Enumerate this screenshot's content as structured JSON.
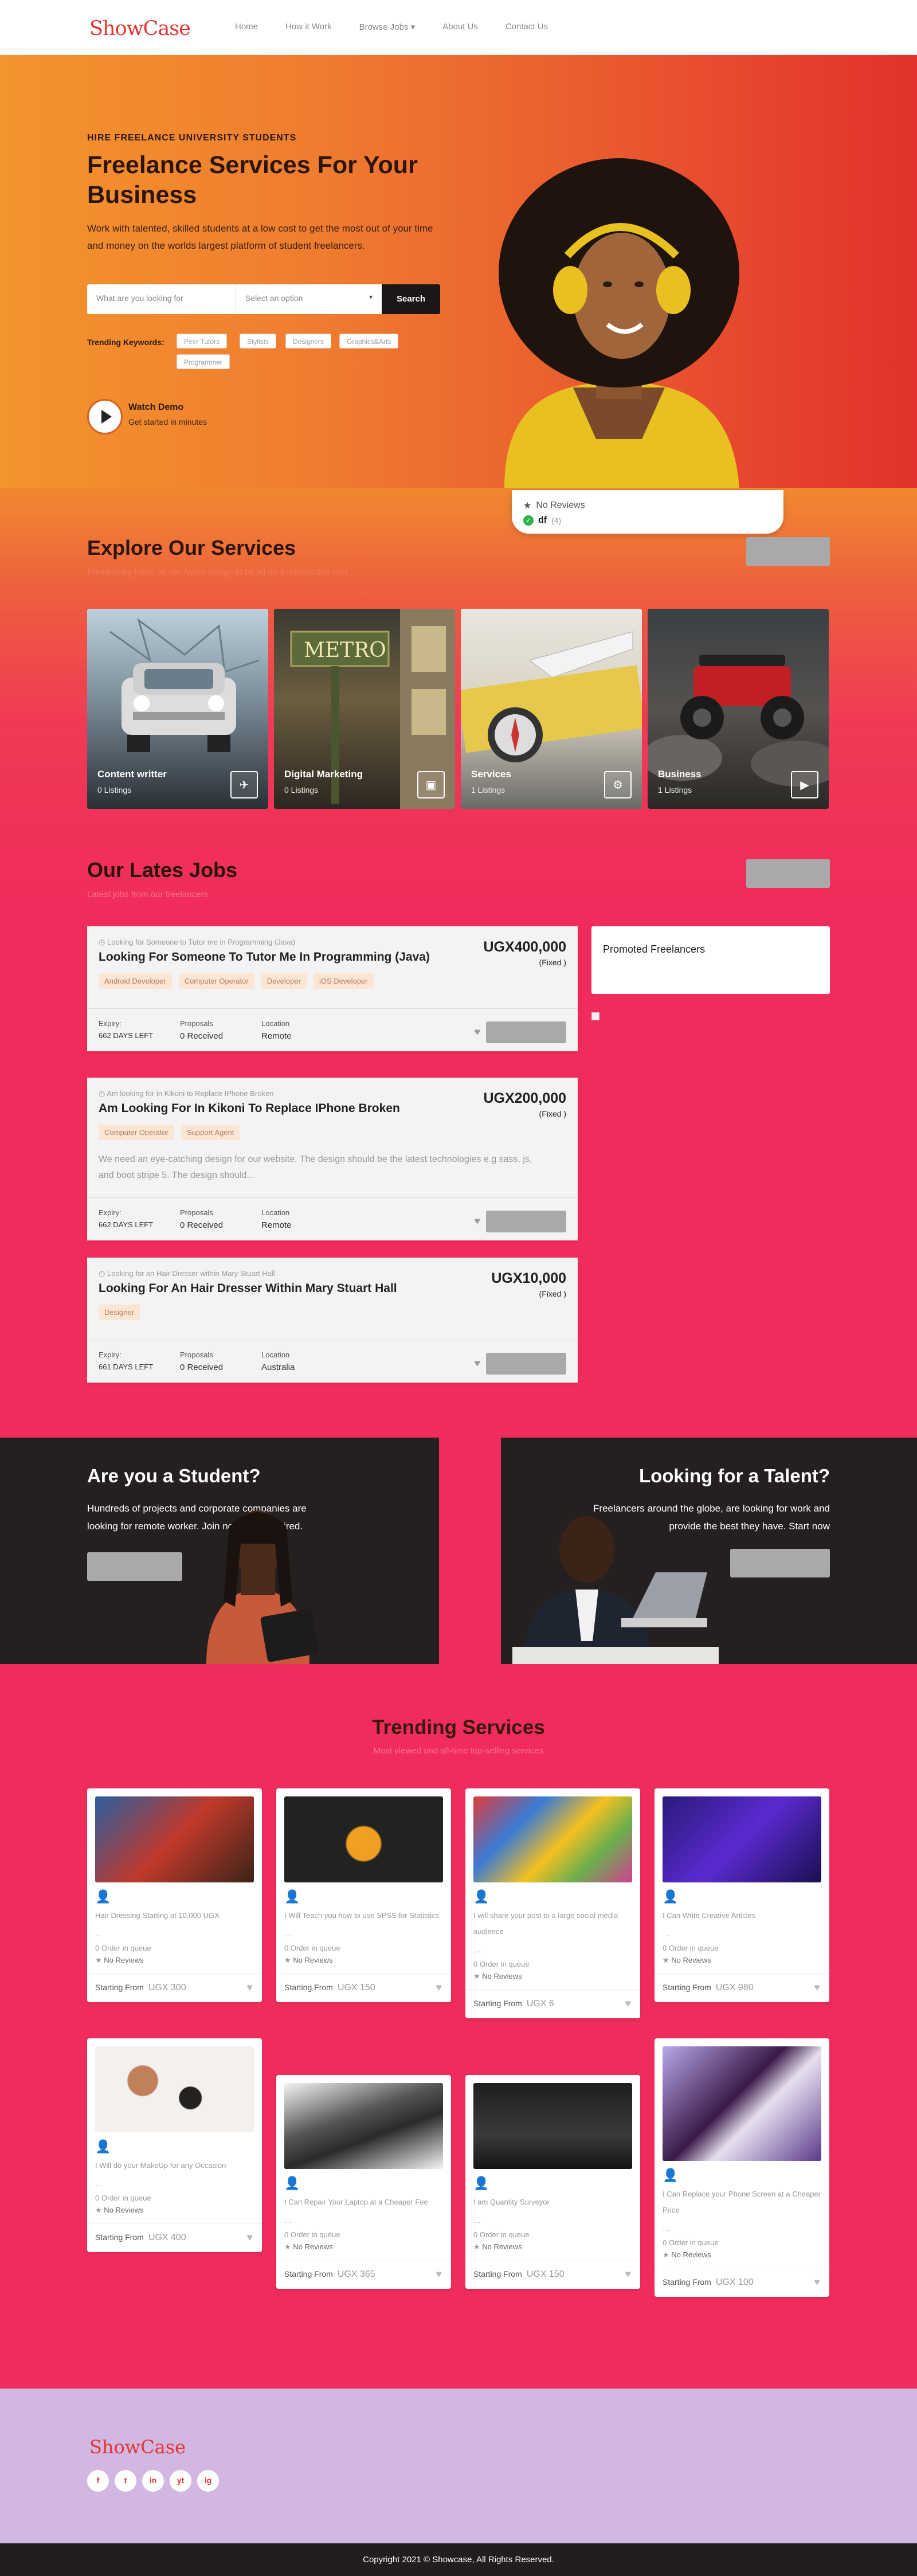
{
  "header": {
    "logo": "ShowCase",
    "nav": [
      "Home",
      "How it Work",
      "Browse Jobs",
      "About Us",
      "Contact Us"
    ]
  },
  "hero": {
    "kicker": "HIRE FREELANCE UNIVERSITY STUDENTS",
    "title": "Freelance Services For Your Business",
    "subtitle": "Work with talented, skilled students at a low cost to get the most out of your time and money on the worlds largest platform of student freelancers.",
    "search_placeholder": "What are you looking for",
    "select_label": "Select an option",
    "search_button": "Search",
    "trending_label": "Trending Keywords:",
    "keywords": [
      "Peer Tutors",
      "Stylists",
      "Designers",
      "Graphics&Arts",
      "Programmer"
    ],
    "demo_title": "Watch Demo",
    "demo_sub": "Get started in minutes",
    "review_line1": "No Reviews",
    "review_line2": "df",
    "review_line2_count": "(4)"
  },
  "services": {
    "title": "Explore Our Services",
    "subtitle": "Freelancing listed on our Alpha design to be all on a remarkable cost",
    "items": [
      {
        "title": "Content writter",
        "count": "0 Listings",
        "icon": "plane-icon"
      },
      {
        "title": "Digital Marketing",
        "count": "0 Listings",
        "icon": "briefcase-icon"
      },
      {
        "title": "Services",
        "count": "1 Listings",
        "icon": "gear-icon"
      },
      {
        "title": "Business",
        "count": "1 Listings",
        "icon": "video-icon"
      }
    ]
  },
  "jobs": {
    "title": "Our Lates Jobs",
    "subtitle": "Latest jobs from our freelancers",
    "promoted": "Promoted Freelancers",
    "list": [
      {
        "mini": "Looking for Someone to Tutor me in Programming (Java)",
        "title": "Looking For Someone To Tutor Me In Programming (Java)",
        "price": "UGX400,000",
        "fixed": "(Fixed )",
        "tags": [
          "Android Developer",
          "Computer Operator",
          "Developer",
          "iOS Developer"
        ],
        "desc": "",
        "expiry_label": "Expiry:",
        "expiry": "662 DAYS LEFT",
        "proposals_label": "Proposals",
        "proposals": "0 Received",
        "location_label": "Location",
        "location": "Remote"
      },
      {
        "mini": "Am looking for in Kikoni to Replace IPhone Broken",
        "title": "Am Looking For In Kikoni To Replace IPhone Broken",
        "price": "UGX200,000",
        "fixed": "(Fixed )",
        "tags": [
          "Computer Operator",
          "Support Agent"
        ],
        "desc": "We need an eye-catching design for our website. The design should be the latest technologies e.g sass, js, and boot stripe 5. The design should...",
        "expiry_label": "Expiry:",
        "expiry": "662 DAYS LEFT",
        "proposals_label": "Proposals",
        "proposals": "0 Received",
        "location_label": "Location",
        "location": "Remote"
      },
      {
        "mini": "Looking for an Hair Dresser within Mary Stuart Hall",
        "title": "Looking For An Hair Dresser Within Mary Stuart Hall",
        "price": "UGX10,000",
        "fixed": "(Fixed )",
        "tags": [
          "Designer"
        ],
        "desc": "",
        "expiry_label": "Expiry:",
        "expiry": "661 DAYS LEFT",
        "proposals_label": "Proposals",
        "proposals": "0 Received",
        "location_label": "Location",
        "location": "Australia"
      }
    ]
  },
  "student": {
    "title": "Are you a Student?",
    "text": "Hundreds of projects and corporate companies are looking for remote worker. Join now and get hired."
  },
  "talent": {
    "title": "Looking for a Talent?",
    "text": "Freelancers around the globe, are looking for work and provide the best they have. Start now"
  },
  "trending": {
    "title": "Trending Services",
    "subtitle": "Most viewed and all-time top-selling services",
    "cards": [
      {
        "desc": "Hair Dressing Starting at 10,000 UGX",
        "queue": "0 Order in queue",
        "reviews": "No Reviews",
        "from": "Starting From",
        "price": "UGX 300"
      },
      {
        "desc": "I Will Teach you how to use SPSS for Statistics",
        "queue": "0 Order in queue",
        "reviews": "No Reviews",
        "from": "Starting From",
        "price": "UGX 150"
      },
      {
        "desc": "I will share your post to a large social media audience",
        "queue": "0 Order in queue",
        "reviews": "No Reviews",
        "from": "Starting From",
        "price": "UGX 6"
      },
      {
        "desc": "I Can Write Creative Articles",
        "queue": "0 Order in queue",
        "reviews": "No Reviews",
        "from": "Starting From",
        "price": "UGX 980"
      },
      {
        "desc": "I Will do your MakeUp for any Occasion",
        "queue": "0 Order in queue",
        "reviews": "No Reviews",
        "from": "Starting From",
        "price": "UGX 400"
      },
      {
        "desc": "I Can Repair Your Laptop at a Cheaper Fee",
        "queue": "0 Order in queue",
        "reviews": "No Reviews",
        "from": "Starting From",
        "price": "UGX 365"
      },
      {
        "desc": "I am Quantity Surveyor",
        "queue": "0 Order in queue",
        "reviews": "No Reviews",
        "from": "Starting From",
        "price": "UGX 150"
      },
      {
        "desc": "I Can Replace your Phone Screen at a Cheaper Price",
        "queue": "0 Order in queue",
        "reviews": "No Reviews",
        "from": "Starting From",
        "price": "UGX 100"
      }
    ]
  },
  "footer": {
    "logo": "ShowCase",
    "social": [
      "f",
      "t",
      "in",
      "yt",
      "ig"
    ],
    "copyright": "Copyright 2021 © Showcase, All Rights Reserved."
  }
}
